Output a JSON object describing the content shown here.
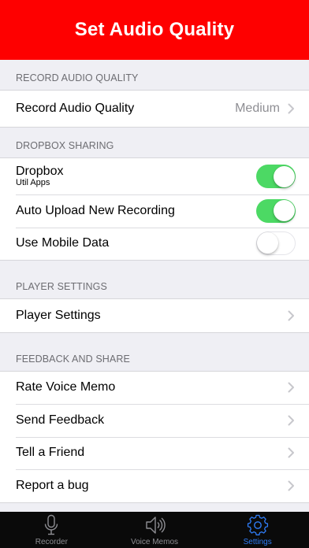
{
  "header": {
    "title": "Set Audio Quality"
  },
  "sections": {
    "record": {
      "title": "RECORD AUDIO QUALITY",
      "quality_label": "Record Audio Quality",
      "quality_value": "Medium"
    },
    "dropbox": {
      "title": "DROPBOX SHARING",
      "dropbox_label": "Dropbox",
      "dropbox_sub": "Util Apps",
      "dropbox_enabled": true,
      "auto_upload_label": "Auto Upload New Recording",
      "auto_upload_enabled": true,
      "mobile_data_label": "Use Mobile Data",
      "mobile_data_enabled": false
    },
    "player": {
      "title": "PLAYER SETTINGS",
      "player_label": "Player Settings"
    },
    "feedback": {
      "title": "FEEDBACK AND SHARE",
      "items": [
        "Rate Voice Memo",
        "Send Feedback",
        "Tell a Friend",
        "Report a bug"
      ]
    }
  },
  "tabbar": {
    "tabs": [
      {
        "label": "Recorder",
        "icon": "microphone-icon"
      },
      {
        "label": "Voice Memos",
        "icon": "speaker-icon"
      },
      {
        "label": "Settings",
        "icon": "gear-icon"
      }
    ],
    "active": "Settings"
  },
  "colors": {
    "header_bg": "#fe0000",
    "toggle_on": "#4cd964",
    "tab_active": "#2f7cf6",
    "tabbar_bg": "#0a0a0a"
  }
}
